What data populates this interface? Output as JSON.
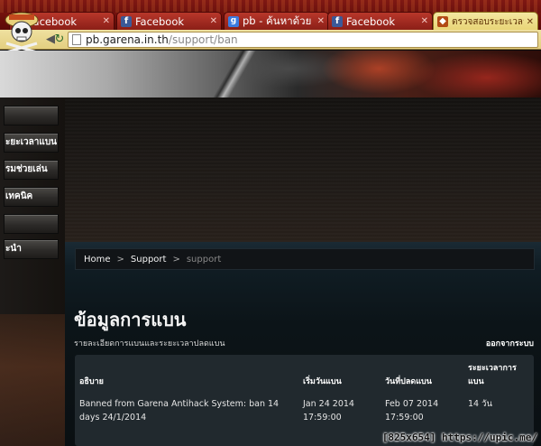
{
  "browser": {
    "tabs": [
      {
        "label": "Facebook",
        "icon": "facebook-icon",
        "active": false
      },
      {
        "label": "Facebook",
        "icon": "facebook-icon",
        "active": false
      },
      {
        "label": "pb - ค้นหาด้วย Go",
        "icon": "google-icon",
        "active": false
      },
      {
        "label": "Facebook",
        "icon": "facebook-icon",
        "active": false
      },
      {
        "label": "ตรวจสอบระยะเวลาก",
        "icon": "garena-icon",
        "active": true
      }
    ],
    "url_host": "pb.garena.in.th",
    "url_path": "/support/ban",
    "theme_accent": "#8a1a14"
  },
  "sidebar": {
    "items": [
      {
        "label": ""
      },
      {
        "label": "ะยะเวลาแบน"
      },
      {
        "label": "รมช่วยเล่น"
      },
      {
        "label": "เทคนิค"
      },
      {
        "label": ""
      },
      {
        "label": "ะนำ"
      }
    ]
  },
  "breadcrumb": {
    "home": "Home",
    "support": "Support",
    "current": "support",
    "separator": ">"
  },
  "main": {
    "title": "ข้อมูลการแบน",
    "subtitle": "รายละเอียดการแบนและระยะเวลาปลดแบน",
    "logout": "ออกจากระบบ"
  },
  "ban_table": {
    "headers": {
      "description": "อธิบาย",
      "start": "เริ่มวันแบน",
      "end": "วันที่ปลดแบน",
      "duration": "ระยะเวลาการแบน"
    },
    "rows": [
      {
        "description": "Banned from Garena Antihack System: ban 14 days 24/1/2014",
        "start": "Jan 24 2014 17:59:00",
        "end": "Feb 07 2014 17:59:00",
        "duration": "14 วัน"
      }
    ]
  },
  "watermark": "[825x654] https://upic.me/"
}
